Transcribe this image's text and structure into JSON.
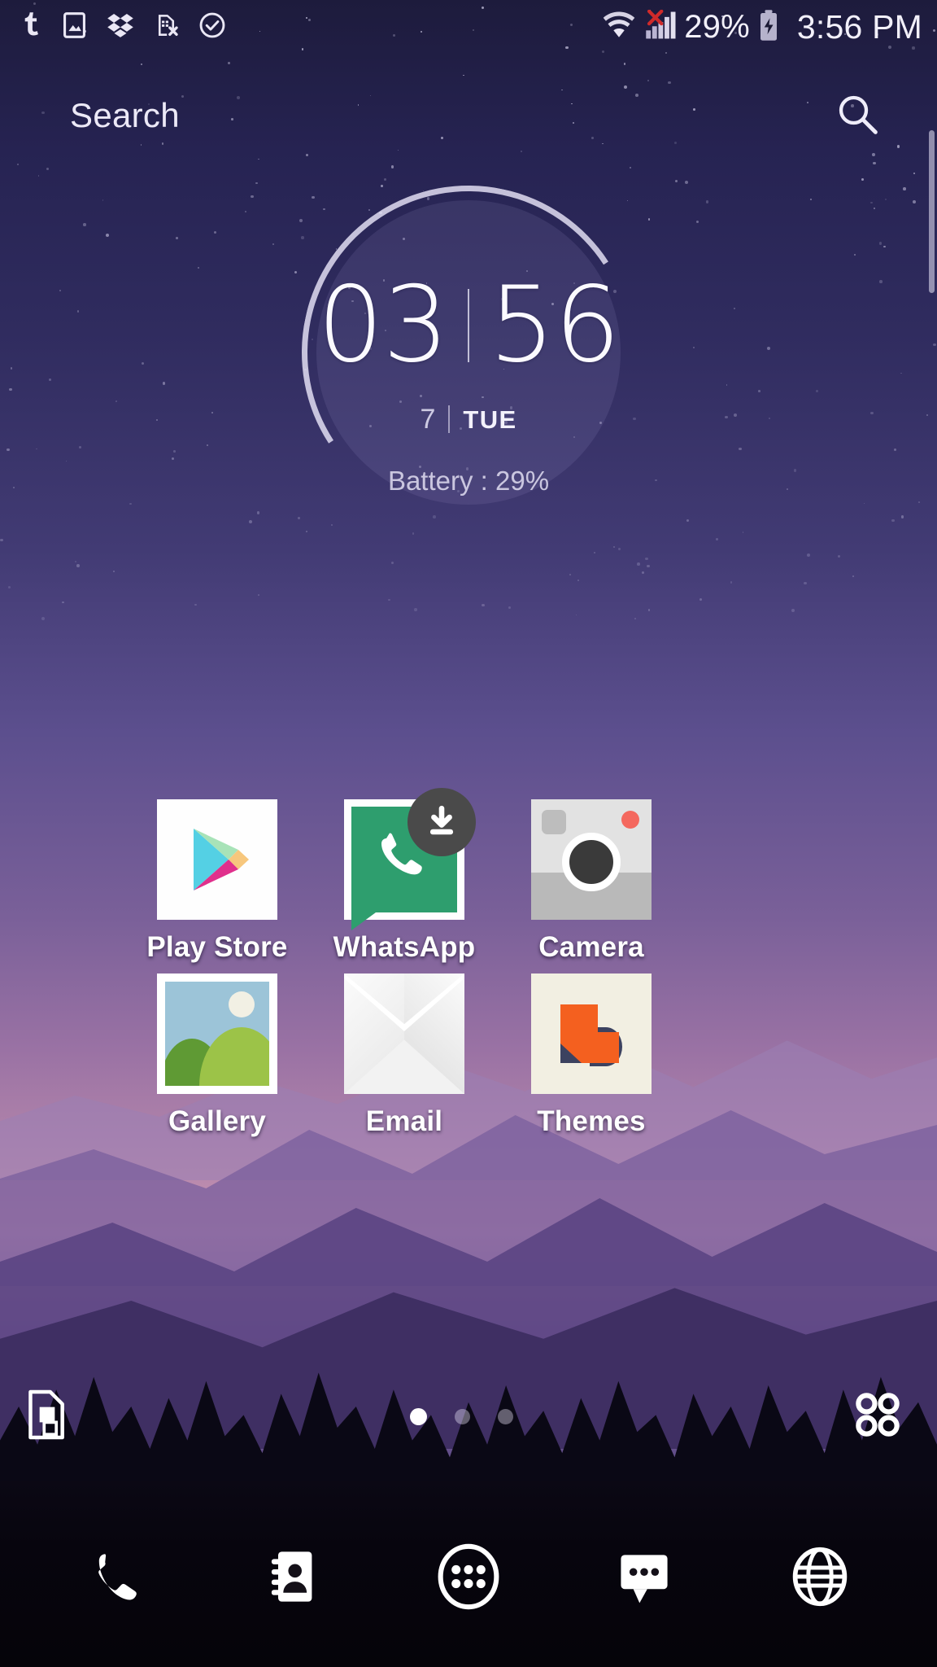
{
  "status_bar": {
    "left_icons": [
      {
        "name": "tumblr-icon",
        "label": "Tumblr"
      },
      {
        "name": "screenshot-icon",
        "label": "Screenshot"
      },
      {
        "name": "dropbox-icon",
        "label": "Dropbox"
      },
      {
        "name": "sim-card-error-icon",
        "label": "No SIM card"
      },
      {
        "name": "check-circle-icon",
        "label": "Completed"
      }
    ],
    "right_icons": [
      {
        "name": "wifi-icon",
        "label": "Wi-Fi connected"
      },
      {
        "name": "cellular-signal-no-service-icon",
        "label": "No mobile service"
      },
      {
        "name": "battery-charging-icon",
        "label": "Battery charging"
      }
    ],
    "battery_percent": "29%",
    "time": "3:56 PM"
  },
  "search": {
    "label": "Search",
    "icon": "search-icon"
  },
  "clock_widget": {
    "hours": "03",
    "minutes": "56",
    "day_of_month": "7",
    "day_of_week": "TUE",
    "battery_line": "Battery : 29%"
  },
  "apps": {
    "rows": [
      [
        {
          "name": "play-store",
          "label": "Play Store",
          "badge": null
        },
        {
          "name": "whatsapp",
          "label": "WhatsApp",
          "badge": "download-badge"
        },
        {
          "name": "camera",
          "label": "Camera",
          "badge": null
        }
      ],
      [
        {
          "name": "gallery",
          "label": "Gallery",
          "badge": null
        },
        {
          "name": "email",
          "label": "Email",
          "badge": null
        },
        {
          "name": "themes",
          "label": "Themes",
          "badge": null
        }
      ]
    ]
  },
  "page_indicator": {
    "total": 3,
    "active_index": 0,
    "left_icon": "wallpaper-page-icon",
    "right_icon": "widgets-grid-icon"
  },
  "dock": {
    "items": [
      {
        "name": "phone",
        "label": "Phone",
        "icon": "phone-icon"
      },
      {
        "name": "contacts",
        "label": "Contacts",
        "icon": "contacts-book-icon"
      },
      {
        "name": "app-drawer",
        "label": "Apps",
        "icon": "app-drawer-icon"
      },
      {
        "name": "messages",
        "label": "Messages",
        "icon": "message-bubble-icon"
      },
      {
        "name": "browser",
        "label": "Browser",
        "icon": "globe-icon"
      }
    ]
  },
  "colors": {
    "accent_white": "#ffffff",
    "wallpaper_top": "#1d1b3c",
    "wallpaper_mid": "#c693b2",
    "wallpaper_bottom": "#07060d",
    "whatsapp_green": "#2e9e6e",
    "themes_orange": "#f4601f",
    "themes_navy": "#3c4260",
    "signal_error_red": "#cf2a2a"
  }
}
